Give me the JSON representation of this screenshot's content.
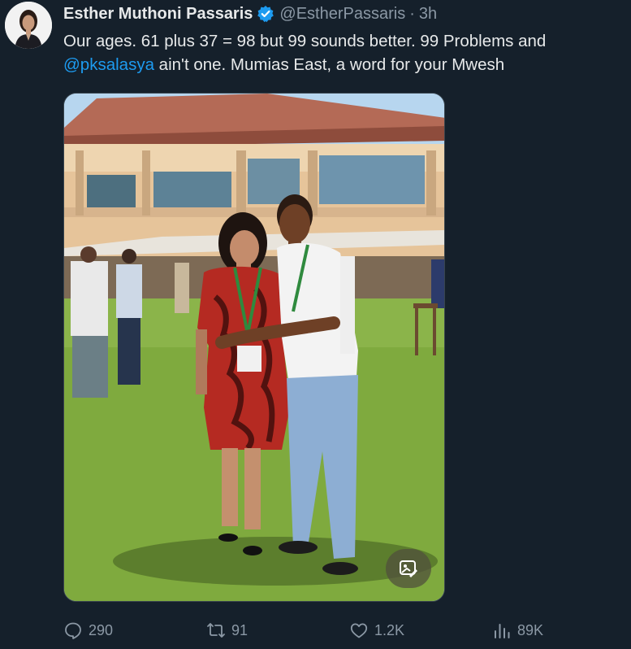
{
  "tweet": {
    "author_name": "Esther Muthoni Passaris",
    "author_handle": "@EstherPassaris",
    "separator": "·",
    "timestamp": "3h",
    "text_part1": "Our ages. 61 plus 37 = 98 but 99 sounds better. 99 Problems and ",
    "mention": "@pksalasya",
    "text_part2": " ain't one. Mumias East, a word for your Mwesh"
  },
  "actions": {
    "replies": "290",
    "retweets": "91",
    "likes": "1.2K",
    "views": "89K"
  },
  "icons": {
    "verified": "verified-badge-icon",
    "alt": "image-alt-icon",
    "reply": "reply-icon",
    "retweet": "retweet-icon",
    "like": "heart-icon",
    "views": "views-chart-icon"
  },
  "colors": {
    "background": "#15202b",
    "accent": "#1d9bf0",
    "muted": "#8b98a5"
  }
}
